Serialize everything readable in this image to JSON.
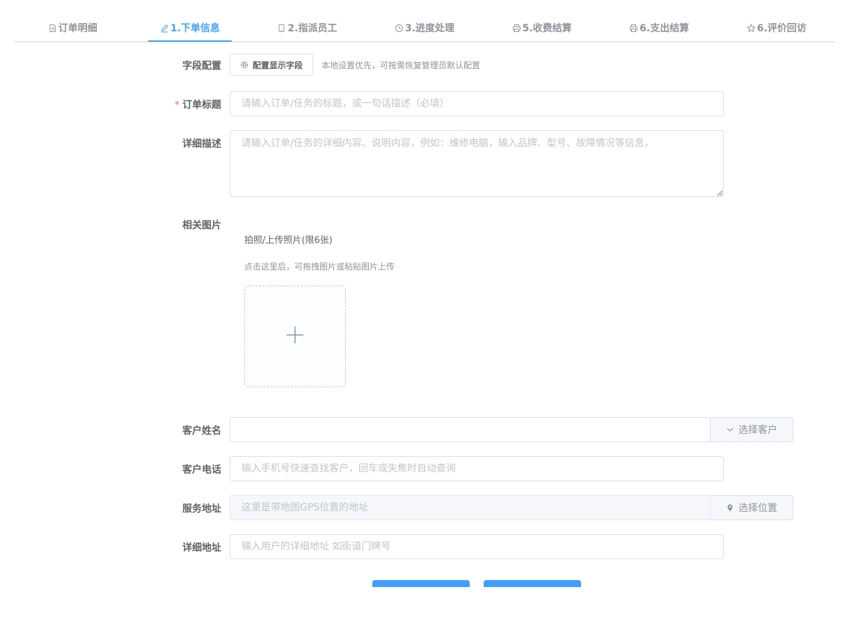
{
  "tabs": [
    {
      "label": "订单明细",
      "icon": "document-icon"
    },
    {
      "label": "1.下单信息",
      "icon": "edit-icon"
    },
    {
      "label": "2.指派员工",
      "icon": "phone-icon"
    },
    {
      "label": "3.进度处理",
      "icon": "clock-icon"
    },
    {
      "label": "5.收费结算",
      "icon": "printer-icon"
    },
    {
      "label": "6.支出结算",
      "icon": "printer-icon"
    },
    {
      "label": "6.评价回访",
      "icon": "star-icon"
    }
  ],
  "active_tab_index": 1,
  "colors": {
    "accent": "#409eff",
    "required": "#f56c6c"
  },
  "form": {
    "field_config": {
      "label": "字段配置",
      "button_label": "配置显示字段",
      "hint": "本地设置优先，可按需恢复管理员默认配置"
    },
    "order_title": {
      "label": "订单标题",
      "required_mark": "*",
      "value": "",
      "placeholder": "请输入订单/任务的标题，或一句话描述（必填）"
    },
    "description": {
      "label": "详细描述",
      "value": "",
      "placeholder": "请输入订单/任务的详细内容、说明内容，例如：维修电脑，输入品牌、型号、故障情况等信息，"
    },
    "images": {
      "label": "相关图片",
      "title": "拍照/上传照片(限6张)",
      "hint": "点击这里后，可拖拽图片或粘贴图片上传"
    },
    "customer_name": {
      "label": "客户姓名",
      "value": "",
      "placeholder": "",
      "append_label": "选择客户"
    },
    "customer_phone": {
      "label": "客户电话",
      "value": "",
      "placeholder": "输入手机号快速查找客户，回车或失焦时自动查询"
    },
    "service_address": {
      "label": "服务地址",
      "value": "",
      "placeholder": "这里是带地图GPS位置的地址",
      "append_label": "选择位置"
    },
    "detail_address": {
      "label": "详细地址",
      "value": "",
      "placeholder": "输入用户的详细地址 如街道门牌号"
    }
  }
}
